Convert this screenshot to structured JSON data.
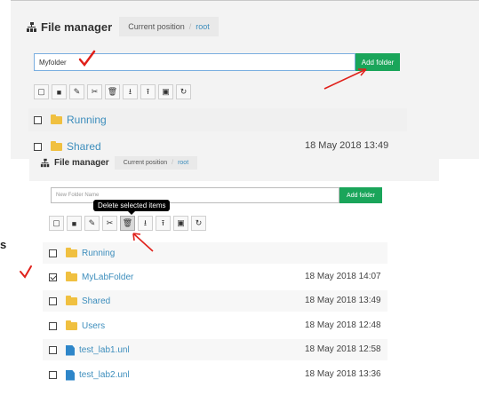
{
  "top": {
    "title": "File manager",
    "breadcrumb_label": "Current position",
    "breadcrumb_sep": "/",
    "breadcrumb_root": "root",
    "folder_input_value": "Myfolder",
    "add_folder_label": "Add folder",
    "rows": [
      {
        "type": "folder",
        "name": "Running",
        "date": ""
      },
      {
        "type": "folder",
        "name": "Shared",
        "date": "18 May 2018 13:49"
      }
    ]
  },
  "bottom": {
    "title": "File manager",
    "breadcrumb_label": "Current position",
    "breadcrumb_sep": "/",
    "breadcrumb_root": "root",
    "folder_input_placeholder": "New Folder Name",
    "add_folder_label": "Add folder",
    "tooltip": "Delete selected items",
    "rows": [
      {
        "type": "folder",
        "name": "Running",
        "date": "",
        "checked": false
      },
      {
        "type": "folder",
        "name": "MyLabFolder",
        "date": "18 May 2018 14:07",
        "checked": true
      },
      {
        "type": "folder",
        "name": "Shared",
        "date": "18 May 2018 13:49",
        "checked": false
      },
      {
        "type": "folder",
        "name": "Users",
        "date": "18 May 2018 12:48",
        "checked": false
      },
      {
        "type": "file",
        "name": "test_lab1.unl",
        "date": "18 May 2018 12:58",
        "checked": false
      },
      {
        "type": "file",
        "name": "test_lab2.unl",
        "date": "18 May 2018 13:36",
        "checked": false
      }
    ]
  },
  "stray_glyph": "s",
  "toolbar_icons": [
    "select-all-icon",
    "new-file-icon",
    "rename-pencil-icon",
    "cut-scissors-icon",
    "delete-trash-icon",
    "import-icon",
    "export-icon",
    "save-icon",
    "refresh-icon"
  ],
  "colors": {
    "accent_green": "#1aa55a",
    "link_blue": "#3c8dbc",
    "folder_yellow": "#f0c040",
    "annotation_red": "#e0201a"
  }
}
